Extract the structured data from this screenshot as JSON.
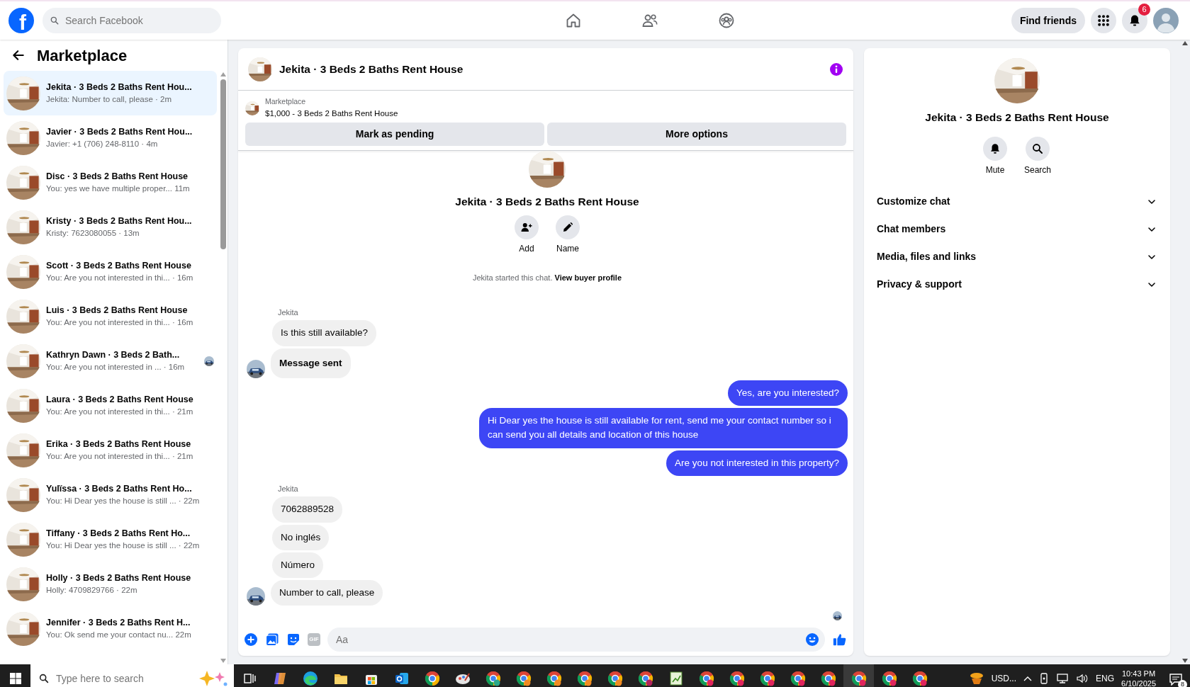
{
  "top_bar": {
    "logo": "f",
    "search": {
      "placeholder": "Search Facebook"
    },
    "find_friends": "Find friends",
    "notification_count": "6"
  },
  "sidebar": {
    "title": "Marketplace",
    "chats": [
      {
        "title": "Jekita · 3 Beds 2 Baths Rent Hou...",
        "meta": "Jekita: Number to call, please · 2m",
        "selected": true,
        "seen": false
      },
      {
        "title": "Javier · 3 Beds 2 Baths Rent Hou...",
        "meta": "Javier: +1 (706) 248-8110 · 4m",
        "selected": false,
        "seen": false
      },
      {
        "title": "Disc · 3 Beds 2 Baths Rent House",
        "meta": "You: yes we have multiple proper...  11m",
        "selected": false,
        "seen": false
      },
      {
        "title": "Kristy · 3 Beds 2 Baths Rent Hou...",
        "meta": "Kristy: 7623080055 · 13m",
        "selected": false,
        "seen": false
      },
      {
        "title": "Scott · 3 Beds 2 Baths Rent House",
        "meta": "You: Are you not interested in thi... · 16m",
        "selected": false,
        "seen": false
      },
      {
        "title": "Luis · 3 Beds 2 Baths Rent House",
        "meta": "You: Are you not interested in thi... · 16m",
        "selected": false,
        "seen": false
      },
      {
        "title": "Kathryn Dawn · 3 Beds 2 Bath...",
        "meta": "You: Are you not interested in ... · 16m",
        "selected": false,
        "seen": true
      },
      {
        "title": "Laura · 3 Beds 2 Baths Rent House",
        "meta": "You: Are you not interested in thi... · 21m",
        "selected": false,
        "seen": false
      },
      {
        "title": "Erika · 3 Beds 2 Baths Rent House",
        "meta": "You: Are you not interested in thi... · 21m",
        "selected": false,
        "seen": false
      },
      {
        "title": "Yulïssa · 3 Beds 2 Baths Rent Ho...",
        "meta": "You: Hi Dear yes the house is still ... · 22m",
        "selected": false,
        "seen": false
      },
      {
        "title": "Tiffany · 3 Beds 2 Baths Rent Ho...",
        "meta": "You: Hi Dear yes the house is still ... · 22m",
        "selected": false,
        "seen": false
      },
      {
        "title": "Holly · 3 Beds 2 Baths Rent House",
        "meta": "Holly: 4709829766 · 22m",
        "selected": false,
        "seen": false
      },
      {
        "title": "Jennifer · 3 Beds 2 Baths Rent H...",
        "meta": "You: Ok send me your contact nu...  22m",
        "selected": false,
        "seen": false
      }
    ]
  },
  "chat": {
    "title": "Jekita · 3 Beds 2 Baths Rent House",
    "listing": {
      "source": "Marketplace",
      "summary": "$1,000 - 3 Beds 2 Baths Rent House"
    },
    "buttons": [
      "Mark as pending",
      "More options"
    ],
    "intro": {
      "title": "Jekita · 3 Beds 2 Baths Rent House",
      "actions": [
        {
          "label": "Add",
          "kind": "add"
        },
        {
          "label": "Name",
          "kind": "pencil"
        }
      ],
      "started": "Jekita started this chat.",
      "link": "View buyer profile"
    },
    "messages": [
      {
        "kind": "sender",
        "text": "Jekita"
      },
      {
        "kind": "in",
        "text": "Is this still available?",
        "bold": false,
        "avatar": false
      },
      {
        "kind": "in",
        "text": "Message sent",
        "bold": true,
        "avatar": true
      },
      {
        "kind": "out",
        "text": "Yes, are you interested?",
        "bold": false
      },
      {
        "kind": "out",
        "text": "Hi Dear yes the house is still available for rent, send me your contact number so i can send you all details and location of this house",
        "bold": false
      },
      {
        "kind": "out",
        "text": "Are you not interested in this property?",
        "bold": false
      },
      {
        "kind": "sender",
        "text": "Jekita"
      },
      {
        "kind": "in",
        "text": "7062889528",
        "bold": false,
        "avatar": false
      },
      {
        "kind": "in",
        "text": "No inglés",
        "bold": false,
        "avatar": false
      },
      {
        "kind": "in",
        "text": "Número",
        "bold": false,
        "avatar": false
      },
      {
        "kind": "in",
        "text": "Number to call, please",
        "bold": false,
        "avatar": true
      }
    ],
    "composer": {
      "gif": "GIF",
      "placeholder": "Aa"
    }
  },
  "details": {
    "title": "Jekita · 3 Beds 2 Baths Rent House",
    "actions": [
      {
        "label": "Mute",
        "kind": "bell"
      },
      {
        "label": "Search",
        "kind": "search"
      }
    ],
    "sections": [
      {
        "label": "Customize chat",
        "expanded": false
      },
      {
        "label": "Chat members",
        "expanded": false
      },
      {
        "label": "Media, files and links",
        "expanded": false
      },
      {
        "label": "Privacy & support",
        "expanded": false
      }
    ]
  },
  "taskbar": {
    "search": {
      "placeholder": "Type here to search"
    },
    "currency": "USD...",
    "language": "ENG",
    "time": "10:43 PM",
    "date": "6/10/2025",
    "notification_count": "8"
  }
}
